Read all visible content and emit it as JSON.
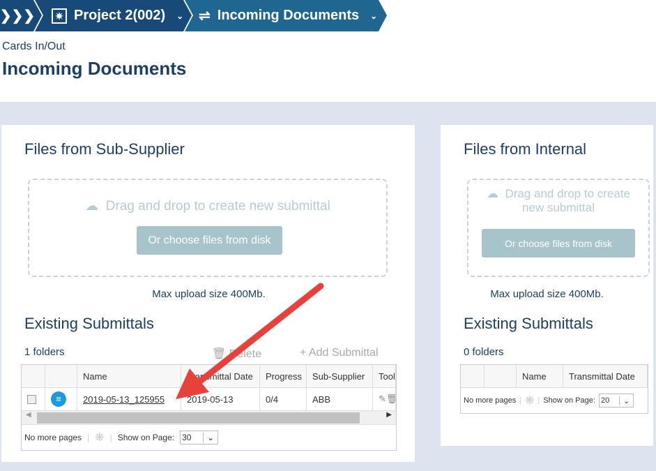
{
  "breadcrumb": {
    "project": "Project 2(002)",
    "section": "Incoming Documents"
  },
  "page": {
    "subtitle": "Cards In/Out",
    "title": "Incoming Documents"
  },
  "left": {
    "title": "Files from Sub-Supplier",
    "drop_text": "Drag and drop to create new submittal",
    "choose_label": "Or choose files from disk",
    "max_upload": "Max upload size 400Mb.",
    "existing_title": "Existing Submittals",
    "folders": "1 folders",
    "delete_label": "Delete",
    "add_label": "Add Submittal",
    "columns": [
      "Name",
      "Transmittal Date",
      "Progress",
      "Sub-Supplier",
      "Tools"
    ],
    "rows": [
      {
        "name": "2019-05-13_125955",
        "date": "2019-05-13",
        "progress": "0/4",
        "supplier": "ABB"
      }
    ],
    "pager": {
      "status": "No more pages",
      "show_label": "Show on Page:",
      "page_size": "30"
    }
  },
  "right": {
    "title": "Files from Internal",
    "drop_text": "Drag and drop to create new submittal",
    "choose_label": "Or choose files from disk",
    "max_upload": "Max upload size 400Mb.",
    "existing_title": "Existing Submittals",
    "folders": "0 folders",
    "columns": [
      "Name",
      "Transmittal Date"
    ],
    "pager": {
      "status": "No more pages",
      "show_label": "Show on Page:",
      "page_size": "20"
    }
  },
  "colors": {
    "header_dark": "#174a78",
    "header_light": "#1f6690",
    "annotation_arrow": "#e8403b"
  }
}
